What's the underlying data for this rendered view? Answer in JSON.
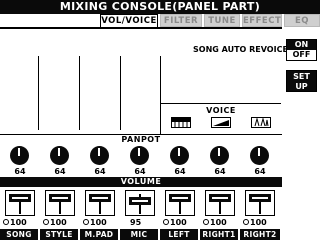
{
  "title": "MIXING CONSOLE(PANEL PART)",
  "tabs": [
    {
      "label": "VOL/VOICE",
      "active": true
    },
    {
      "label": "FILTER",
      "active": false
    },
    {
      "label": "TUNE",
      "active": false
    },
    {
      "label": "EFFECT",
      "active": false
    },
    {
      "label": "EQ",
      "active": false
    }
  ],
  "voice_labels": {
    "song_auto_revoice": "SONG AUTO REVOICE",
    "song": "SONG",
    "auto": "AUTO",
    "revoice": "REVOICE"
  },
  "voice_section": {
    "title": "VOICE",
    "icons": [
      "keyboard-icon",
      "piano-icon",
      "strings-icon"
    ]
  },
  "panpot": {
    "title": "PANPOT",
    "values": [
      "64",
      "64",
      "64",
      "64",
      "64",
      "64",
      "64"
    ]
  },
  "volume": {
    "title": "VOLUME",
    "values": [
      "100",
      "100",
      "100",
      "95",
      "100",
      "100",
      "100"
    ],
    "levels": [
      1.0,
      1.0,
      1.0,
      0.75,
      1.0,
      1.0,
      1.0
    ]
  },
  "parts": [
    "SONG",
    "STYLE",
    "M.PAD",
    "MIC",
    "LEFT",
    "RIGHT1",
    "RIGHT2"
  ],
  "side": {
    "on": "ON",
    "off": "OFF",
    "setup_line1": "SET",
    "setup_line2": "UP"
  },
  "colors": {
    "background": "#ffffff",
    "foreground": "#0a0a0a",
    "tab_inactive": "#cfcfcf"
  }
}
